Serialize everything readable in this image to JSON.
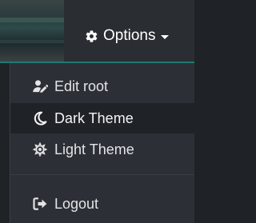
{
  "navbar": {
    "options_label": "Options",
    "options_icon": "gear-icon",
    "caret_icon": "caret-down-icon"
  },
  "menu": {
    "items": [
      {
        "label": "Edit root",
        "icon": "user-edit-icon"
      },
      {
        "label": "Dark Theme",
        "icon": "moon-icon",
        "highlighted": true
      },
      {
        "label": "Light Theme",
        "icon": "sun-icon"
      },
      {
        "label": "Logout",
        "icon": "sign-out-icon"
      }
    ]
  },
  "colors": {
    "navbar_bg": "#2a2e33",
    "menu_bg": "#2c3036",
    "highlight_bg": "#1f2227",
    "accent": "#1e7a72",
    "text": "#e3e4e6"
  }
}
